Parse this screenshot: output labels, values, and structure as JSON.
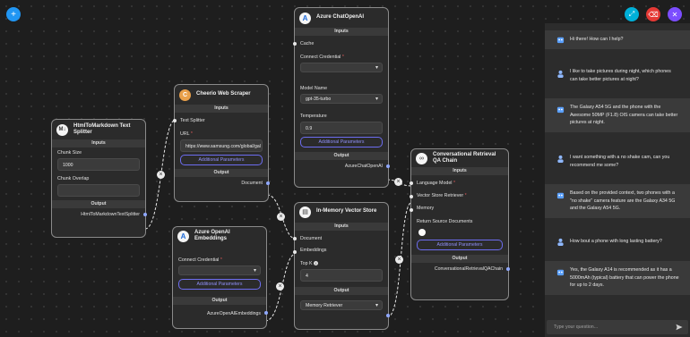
{
  "nodes": {
    "splitter": {
      "title": "HtmlToMarkdown Text Splitter",
      "inputs_label": "Inputs",
      "chunk_size_label": "Chunk Size",
      "chunk_size_value": "1000",
      "chunk_overlap_label": "Chunk Overlap",
      "chunk_overlap_value": "",
      "output_label": "Output",
      "output_name": "HtmlToMarkdownTextSplitter"
    },
    "cheerio": {
      "title": "Cheerio Web Scraper",
      "inputs_label": "Inputs",
      "text_splitter_label": "Text Splitter",
      "url_label": "URL",
      "url_value": "https://www.samsung.com/global/gal",
      "additional_params": "Additional Parameters",
      "output_label": "Output",
      "output_name": "Document"
    },
    "chat_openai": {
      "title": "Azure ChatOpenAI",
      "inputs_label": "Inputs",
      "cache_label": "Cache",
      "credential_label": "Connect Credential",
      "credential_value": "",
      "model_label": "Model Name",
      "model_value": "gpt-35-turbo",
      "temperature_label": "Temperature",
      "temperature_value": "0.9",
      "additional_params": "Additional Parameters",
      "output_label": "Output",
      "output_name": "AzureChatOpenAI"
    },
    "embeddings": {
      "title": "Azure OpenAI Embeddings",
      "credential_label": "Connect Credential",
      "credential_value": "",
      "additional_params": "Additional Parameters",
      "output_label": "Output",
      "output_name": "AzureOpenAIEmbeddings"
    },
    "vector_store": {
      "title": "In-Memory Vector Store",
      "inputs_label": "Inputs",
      "document_label": "Document",
      "embeddings_label": "Embeddings",
      "topk_label": "Top K",
      "topk_value": "4",
      "output_label": "Output",
      "output_value": "Memory Retriever"
    },
    "qa_chain": {
      "title": "Conversational Retrieval QA Chain",
      "inputs_label": "Inputs",
      "language_model_label": "Language Model",
      "retriever_label": "Vector Store Retriever",
      "memory_label": "Memory",
      "return_docs_label": "Return Source Documents",
      "additional_params": "Additional Parameters",
      "output_label": "Output",
      "output_name": "ConversationalRetrievalQAChain"
    }
  },
  "chat": {
    "messages": [
      {
        "role": "bot",
        "text": "Hi there! How can I help?"
      },
      {
        "role": "user",
        "text": "I like to take pictures during night, which phones can take better pictures at night?"
      },
      {
        "role": "bot",
        "text": "The Galaxy A54 5G and the phone with the Awesome 50MP (F1.8) OIS camera can take better pictures at night."
      },
      {
        "role": "user",
        "text": "I want something with a no shake cam, can you recommend me some?"
      },
      {
        "role": "bot",
        "text": "Based on the provided context, two phones with a \"no shake\" camera feature are the Galaxy A34 5G and the Galaxy A54 5G."
      },
      {
        "role": "user",
        "text": "How bout a phone with long lasting battery?"
      },
      {
        "role": "bot",
        "text": "Yes, the Galaxy A14 is recommended as it has a 5000mAh (typical) battery that can power the phone for up to 2 days."
      }
    ],
    "input_placeholder": "Type your question..."
  },
  "colors": {
    "canvas_bg": "#1e1e1e",
    "add_button": "#2196f3",
    "expand_button": "#00b0d8",
    "clear_button": "#e53935",
    "close_button": "#7c4dff",
    "accent": "#6d6df0"
  },
  "icons": [
    "plus-icon",
    "expand-icon",
    "eraser-icon",
    "close-icon",
    "info-icon",
    "send-icon",
    "robot-icon",
    "user-icon"
  ]
}
